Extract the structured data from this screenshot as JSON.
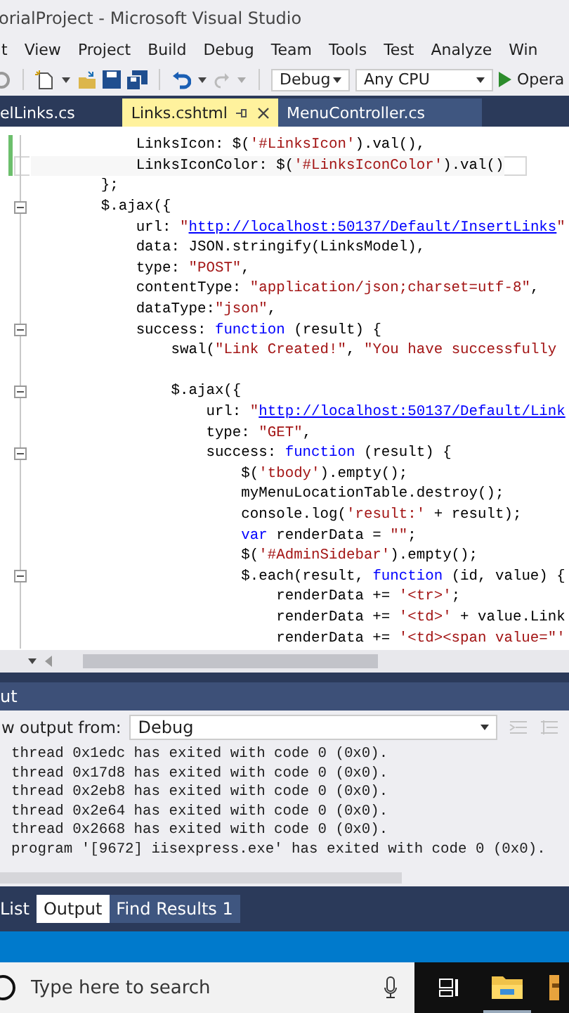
{
  "window": {
    "title": "orialProject - Microsoft Visual Studio"
  },
  "menu": [
    "t",
    "View",
    "Project",
    "Build",
    "Debug",
    "Team",
    "Tools",
    "Test",
    "Analyze",
    "Win"
  ],
  "toolbar": {
    "configuration": "Debug",
    "platform": "Any CPU",
    "run_label": "Opera"
  },
  "editor_tabs": [
    {
      "label": "elLinks.cs",
      "selected": false
    },
    {
      "label": "Links.cshtml",
      "selected": true
    },
    {
      "label": "MenuController.cs",
      "selected": false
    }
  ],
  "code_lines": [
    {
      "changed": true,
      "current": false,
      "collapsible": false,
      "segments": [
        {
          "kind": "plain",
          "text": "            LinksIcon: $("
        },
        {
          "kind": "string",
          "text": "'#LinksIcon'"
        },
        {
          "kind": "plain",
          "text": ").val(),"
        }
      ]
    },
    {
      "changed": true,
      "current": true,
      "collapsible": false,
      "segments": [
        {
          "kind": "plain",
          "text": "            LinksIconColor: $("
        },
        {
          "kind": "string",
          "text": "'#LinksIconColor'"
        },
        {
          "kind": "plain",
          "text": ").val()"
        }
      ]
    },
    {
      "changed": false,
      "current": false,
      "collapsible": false,
      "segments": [
        {
          "kind": "plain",
          "text": "        };"
        }
      ]
    },
    {
      "changed": false,
      "current": false,
      "collapsible": true,
      "segments": [
        {
          "kind": "plain",
          "text": "        $.ajax({"
        }
      ]
    },
    {
      "changed": false,
      "current": false,
      "collapsible": false,
      "segments": [
        {
          "kind": "plain",
          "text": "            url: "
        },
        {
          "kind": "string",
          "text": "\""
        },
        {
          "kind": "link",
          "text": "http://localhost:50137/Default/InsertLinks"
        },
        {
          "kind": "string",
          "text": "\""
        }
      ]
    },
    {
      "changed": false,
      "current": false,
      "collapsible": false,
      "segments": [
        {
          "kind": "plain",
          "text": "            data: JSON.stringify(LinksModel),"
        }
      ]
    },
    {
      "changed": false,
      "current": false,
      "collapsible": false,
      "segments": [
        {
          "kind": "plain",
          "text": "            type: "
        },
        {
          "kind": "string",
          "text": "\"POST\""
        },
        {
          "kind": "plain",
          "text": ","
        }
      ]
    },
    {
      "changed": false,
      "current": false,
      "collapsible": false,
      "segments": [
        {
          "kind": "plain",
          "text": "            contentType: "
        },
        {
          "kind": "string",
          "text": "\"application/json;charset=utf-8\""
        },
        {
          "kind": "plain",
          "text": ","
        }
      ]
    },
    {
      "changed": false,
      "current": false,
      "collapsible": false,
      "segments": [
        {
          "kind": "plain",
          "text": "            dataType:"
        },
        {
          "kind": "string",
          "text": "\"json\""
        },
        {
          "kind": "plain",
          "text": ","
        }
      ]
    },
    {
      "changed": false,
      "current": false,
      "collapsible": true,
      "segments": [
        {
          "kind": "plain",
          "text": "            success: "
        },
        {
          "kind": "keyword",
          "text": "function"
        },
        {
          "kind": "plain",
          "text": " (result) {"
        }
      ]
    },
    {
      "changed": false,
      "current": false,
      "collapsible": false,
      "segments": [
        {
          "kind": "plain",
          "text": "                swal("
        },
        {
          "kind": "string",
          "text": "\"Link Created!\""
        },
        {
          "kind": "plain",
          "text": ", "
        },
        {
          "kind": "string",
          "text": "\"You have successfully"
        }
      ]
    },
    {
      "changed": false,
      "current": false,
      "collapsible": false
    },
    {
      "changed": false,
      "current": false,
      "collapsible": true,
      "segments": [
        {
          "kind": "plain",
          "text": "                $.ajax({"
        }
      ]
    },
    {
      "changed": false,
      "current": false,
      "collapsible": false,
      "segments": [
        {
          "kind": "plain",
          "text": "                    url: "
        },
        {
          "kind": "string",
          "text": "\""
        },
        {
          "kind": "link",
          "text": "http://localhost:50137/Default/Link"
        }
      ]
    },
    {
      "changed": false,
      "current": false,
      "collapsible": false,
      "segments": [
        {
          "kind": "plain",
          "text": "                    type: "
        },
        {
          "kind": "string",
          "text": "\"GET\""
        },
        {
          "kind": "plain",
          "text": ","
        }
      ]
    },
    {
      "changed": false,
      "current": false,
      "collapsible": true,
      "segments": [
        {
          "kind": "plain",
          "text": "                    success: "
        },
        {
          "kind": "keyword",
          "text": "function"
        },
        {
          "kind": "plain",
          "text": " (result) {"
        }
      ]
    },
    {
      "changed": false,
      "current": false,
      "collapsible": false,
      "segments": [
        {
          "kind": "plain",
          "text": "                        $("
        },
        {
          "kind": "string",
          "text": "'tbody'"
        },
        {
          "kind": "plain",
          "text": ").empty();"
        }
      ]
    },
    {
      "changed": false,
      "current": false,
      "collapsible": false,
      "segments": [
        {
          "kind": "plain",
          "text": "                        myMenuLocationTable.destroy();"
        }
      ]
    },
    {
      "changed": false,
      "current": false,
      "collapsible": false,
      "segments": [
        {
          "kind": "plain",
          "text": "                        console.log("
        },
        {
          "kind": "string",
          "text": "'result:'"
        },
        {
          "kind": "plain",
          "text": " + result);"
        }
      ]
    },
    {
      "changed": false,
      "current": false,
      "collapsible": false,
      "segments": [
        {
          "kind": "keyword",
          "text": "                        var"
        },
        {
          "kind": "plain",
          "text": " renderData = "
        },
        {
          "kind": "string",
          "text": "\"\""
        },
        {
          "kind": "plain",
          "text": ";"
        }
      ]
    },
    {
      "changed": false,
      "current": false,
      "collapsible": false,
      "segments": [
        {
          "kind": "plain",
          "text": "                        $("
        },
        {
          "kind": "string",
          "text": "'#AdminSidebar'"
        },
        {
          "kind": "plain",
          "text": ").empty();"
        }
      ]
    },
    {
      "changed": false,
      "current": false,
      "collapsible": true,
      "segments": [
        {
          "kind": "plain",
          "text": "                        $.each(result, "
        },
        {
          "kind": "keyword",
          "text": "function"
        },
        {
          "kind": "plain",
          "text": " (id, value) {"
        }
      ]
    },
    {
      "changed": false,
      "current": false,
      "collapsible": false,
      "segments": [
        {
          "kind": "plain",
          "text": "                            renderData += "
        },
        {
          "kind": "string",
          "text": "'<tr>'"
        },
        {
          "kind": "plain",
          "text": ";"
        }
      ]
    },
    {
      "changed": false,
      "current": false,
      "collapsible": false,
      "segments": [
        {
          "kind": "plain",
          "text": "                            renderData += "
        },
        {
          "kind": "string",
          "text": "'<td>'"
        },
        {
          "kind": "plain",
          "text": " + value.Link"
        }
      ]
    },
    {
      "changed": false,
      "current": false,
      "collapsible": false,
      "segments": [
        {
          "kind": "plain",
          "text": "                            renderData += "
        },
        {
          "kind": "string",
          "text": "'<td><span value=\"'"
        }
      ]
    }
  ],
  "output": {
    "title": "ut",
    "show_from_label": "w output from:",
    "source": "Debug",
    "lines": [
      "thread 0x1edc has exited with code 0 (0x0).",
      "thread 0x17d8 has exited with code 0 (0x0).",
      "thread 0x2eb8 has exited with code 0 (0x0).",
      "thread 0x2e64 has exited with code 0 (0x0).",
      "thread 0x2668 has exited with code 0 (0x0).",
      "program '[9672] iisexpress.exe' has exited with code 0 (0x0)."
    ]
  },
  "panel_tabs": [
    {
      "label": "List",
      "selected": false
    },
    {
      "label": "Output",
      "selected": true
    },
    {
      "label": "Find Results 1",
      "selected": false
    }
  ],
  "taskbar": {
    "search": {
      "placeholder": "Type here to search"
    }
  }
}
